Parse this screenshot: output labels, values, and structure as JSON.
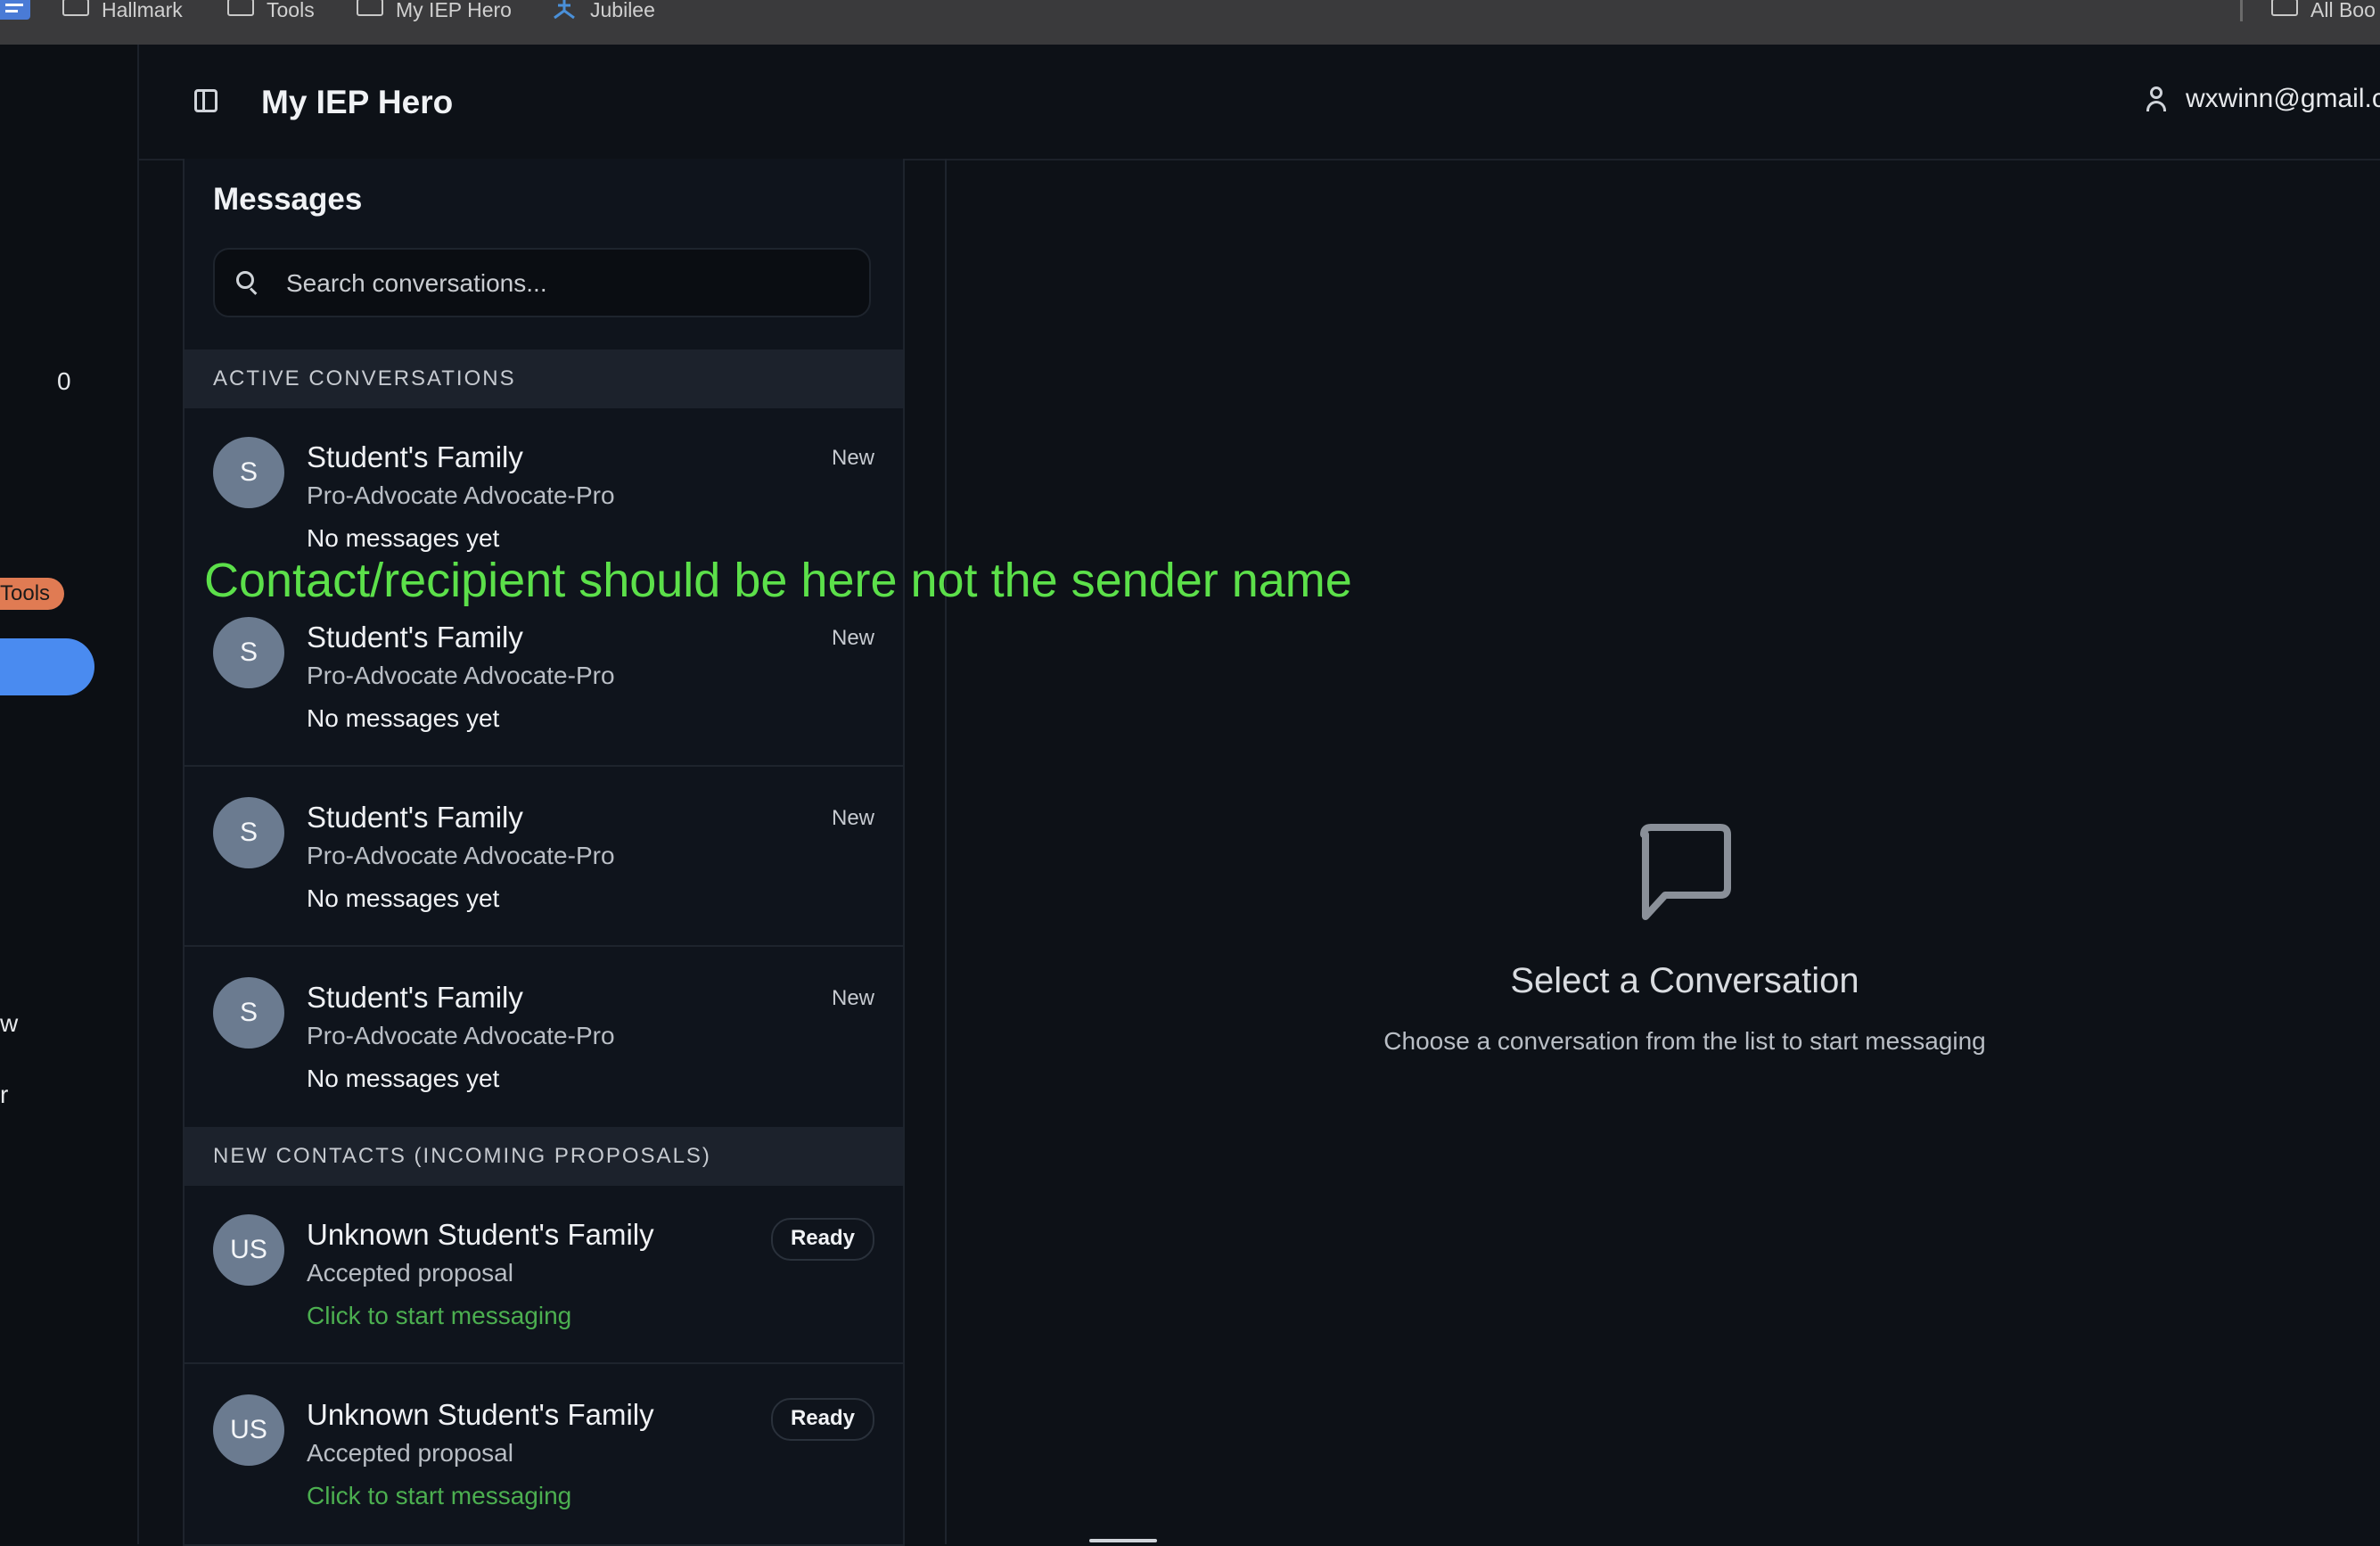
{
  "bookmarks": {
    "items": [
      {
        "label": "Hallmark",
        "icon": "folder-icon"
      },
      {
        "label": "Tools",
        "icon": "folder-icon"
      },
      {
        "label": "My IEP Hero",
        "icon": "folder-icon"
      },
      {
        "label": "Jubilee",
        "icon": "jubilee-logo-icon"
      }
    ],
    "all_bookmarks": "All Boo"
  },
  "rail": {
    "count": "0",
    "tools_badge": "Tools",
    "partial_text_1": "w",
    "partial_text_2": "r"
  },
  "header": {
    "app_title": "My IEP Hero",
    "user_email": "wxwinn@gmail.c"
  },
  "messages": {
    "title": "Messages",
    "search_placeholder": "Search conversations...",
    "active_section": "ACTIVE CONVERSATIONS",
    "active_conversations": [
      {
        "avatar": "S",
        "name": "Student's Family",
        "subtitle": "Pro-Advocate Advocate-Pro",
        "preview": "No messages yet",
        "status": "New"
      },
      {
        "avatar": "S",
        "name": "Student's Family",
        "subtitle": "Pro-Advocate Advocate-Pro",
        "preview": "No messages yet",
        "status": "New"
      },
      {
        "avatar": "S",
        "name": "Student's Family",
        "subtitle": "Pro-Advocate Advocate-Pro",
        "preview": "No messages yet",
        "status": "New"
      },
      {
        "avatar": "S",
        "name": "Student's Family",
        "subtitle": "Pro-Advocate Advocate-Pro",
        "preview": "No messages yet",
        "status": "New"
      }
    ],
    "new_section": "NEW CONTACTS (INCOMING PROPOSALS)",
    "new_contacts": [
      {
        "avatar": "US",
        "name": "Unknown Student's Family",
        "subtitle": "Accepted proposal",
        "preview": "Click to start messaging",
        "status": "Ready"
      },
      {
        "avatar": "US",
        "name": "Unknown Student's Family",
        "subtitle": "Accepted proposal",
        "preview": "Click to start messaging",
        "status": "Ready"
      }
    ]
  },
  "annotation": "Contact/recipient should be here not the sender name",
  "empty_state": {
    "icon": "message-square-icon",
    "title": "Select a Conversation",
    "subtitle": "Choose a conversation from the list to start messaging"
  },
  "colors": {
    "background": "#0d1117",
    "panel": "#0f141c",
    "section_header": "#1c222c",
    "avatar": "#6b7b90",
    "green_link": "#4caf50",
    "annotation": "#5ce04a",
    "tools_badge": "#e07b53",
    "rail_pill": "#4a8bf0"
  }
}
